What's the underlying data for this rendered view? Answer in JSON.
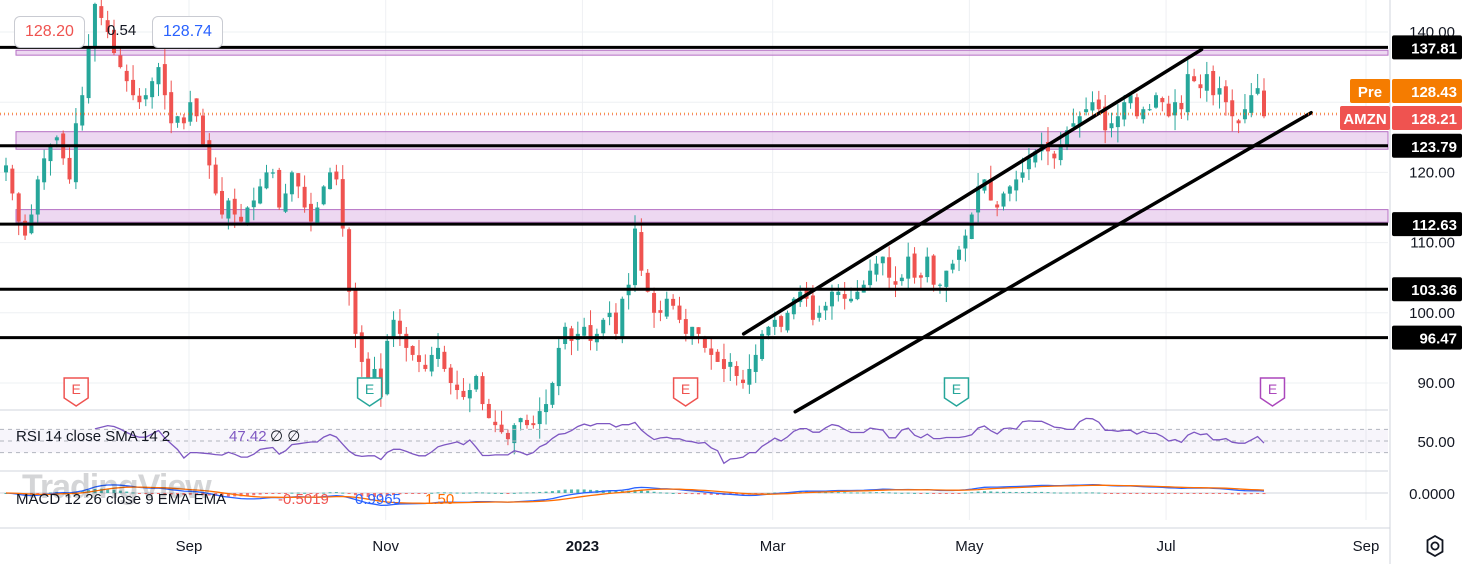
{
  "chart_data": {
    "type": "candlestick",
    "symbol": "AMZN",
    "x_ticks": [
      "Sep",
      "Nov",
      "2023",
      "Mar",
      "May",
      "Jul",
      "Sep"
    ],
    "y_ticks": [
      "140.00",
      "120.00",
      "110.00",
      "100.00",
      "90.00"
    ],
    "ylim": [
      85,
      142
    ],
    "header": {
      "low_label": "128.20",
      "spread_label": "0.54",
      "high_label": "128.74"
    },
    "price_tags": [
      {
        "label": "Pre",
        "value": "128.43",
        "color": "#f57c00"
      },
      {
        "label": "AMZN",
        "value": "128.21",
        "color": "#ef5350"
      }
    ],
    "levels": [
      {
        "value": 137.81,
        "label": "137.81"
      },
      {
        "value": 123.79,
        "label": "123.79"
      },
      {
        "value": 112.63,
        "label": "112.63"
      },
      {
        "value": 103.36,
        "label": "103.36"
      },
      {
        "value": 96.47,
        "label": "96.47"
      }
    ],
    "zones": [
      {
        "from": 136.7,
        "to": 137.4
      },
      {
        "from": 123.3,
        "to": 125.8
      },
      {
        "from": 112.9,
        "to": 114.7
      }
    ],
    "channel": {
      "upper": [
        {
          "date": "2023-02-20",
          "price": 97.0
        },
        {
          "date": "2023-07-12",
          "price": 137.5
        }
      ],
      "lower": [
        {
          "date": "2023-03-08",
          "price": 85.9
        },
        {
          "date": "2023-08-15",
          "price": 128.5
        }
      ]
    },
    "earnings": [
      {
        "date": "2022-07-28",
        "label": "E",
        "status": "past"
      },
      {
        "date": "2022-10-27",
        "label": "E",
        "status": "beat"
      },
      {
        "date": "2023-02-02",
        "label": "E",
        "status": "past"
      },
      {
        "date": "2023-04-27",
        "label": "E",
        "status": "beat"
      },
      {
        "date": "2023-08-03",
        "label": "E",
        "status": "upcoming"
      }
    ],
    "candles_monthly_path": [
      {
        "period": "Jul-22",
        "prices": [
          121,
          117,
          113,
          111,
          114,
          119,
          122,
          124,
          125,
          122,
          119
        ]
      },
      {
        "period": "Aug-22",
        "prices": [
          127,
          131,
          138,
          144,
          142,
          140,
          137,
          135,
          133,
          131,
          130,
          131
        ]
      },
      {
        "period": "Sep-22",
        "prices": [
          133,
          135,
          131,
          127,
          128,
          127,
          130,
          128,
          124,
          121,
          117,
          114,
          116,
          114,
          113
        ]
      },
      {
        "period": "Oct-22",
        "prices": [
          115,
          116,
          118,
          120,
          120,
          115,
          117,
          120,
          118,
          115,
          113,
          115,
          118,
          120,
          119,
          112
        ]
      },
      {
        "period": "Nov-22",
        "prices": [
          103,
          97,
          93,
          90,
          92,
          88,
          96,
          99,
          97,
          95,
          94,
          93,
          92,
          94,
          95
        ]
      },
      {
        "period": "Dec-22",
        "prices": [
          92,
          90,
          89,
          88,
          89,
          91,
          87,
          85,
          84,
          83,
          82,
          84
        ]
      },
      {
        "period": "Jan-23",
        "prices": [
          85,
          84,
          84,
          86,
          87,
          90,
          95,
          98,
          96,
          97,
          98,
          96,
          97,
          99,
          100,
          97,
          102,
          104
        ]
      },
      {
        "period": "Feb-23",
        "prices": [
          112,
          106,
          103,
          100,
          100,
          102,
          101,
          99,
          97,
          98,
          97,
          95
        ]
      },
      {
        "period": "Mar-23",
        "prices": [
          94,
          93,
          92,
          93,
          91,
          90,
          92,
          94,
          97,
          98,
          99,
          98,
          100,
          102,
          103,
          102,
          99,
          100,
          101,
          103,
          103,
          102,
          102
        ]
      },
      {
        "period": "Apr-23",
        "prices": [
          103,
          104,
          106,
          107,
          108,
          105,
          104,
          105,
          108,
          105,
          105,
          108,
          104,
          104,
          106,
          107
        ]
      },
      {
        "period": "May-23",
        "prices": [
          109,
          111,
          114,
          118,
          119,
          116,
          115,
          117,
          118,
          119,
          120,
          122,
          123,
          124,
          123,
          122,
          124,
          126
        ]
      },
      {
        "period": "Jun-23",
        "prices": [
          127,
          128,
          129,
          130,
          129,
          126,
          127,
          128,
          130,
          131,
          128,
          129,
          129,
          131,
          130,
          128,
          130,
          129
        ]
      },
      {
        "period": "Jul-23",
        "prices": [
          134,
          133,
          132,
          134,
          131,
          132,
          130,
          128,
          127,
          129,
          131,
          132,
          128
        ]
      }
    ],
    "rsi": {
      "label": "RSI 14 close SMA 14 2",
      "value": "47.42",
      "extra": "∅ ∅",
      "ylim": [
        0,
        100
      ],
      "y_ticks": [
        "50.00"
      ],
      "upper_band": 70,
      "lower_band": 30
    },
    "macd": {
      "label": "MACD 12 26 close 9 EMA EMA",
      "histogram": "-0.5019",
      "macd": "0.9965",
      "signal": "1.50",
      "y_ticks": [
        "0.0000"
      ]
    },
    "colors": {
      "up": "#26a69a",
      "down": "#ef5350",
      "level": "#000000",
      "zone": "#e1bee7",
      "rsi": "#7e57c2",
      "macd": "#2962ff",
      "signal": "#ff6d00"
    }
  },
  "watermark": "TradingView",
  "settings_icon": "gear-icon"
}
